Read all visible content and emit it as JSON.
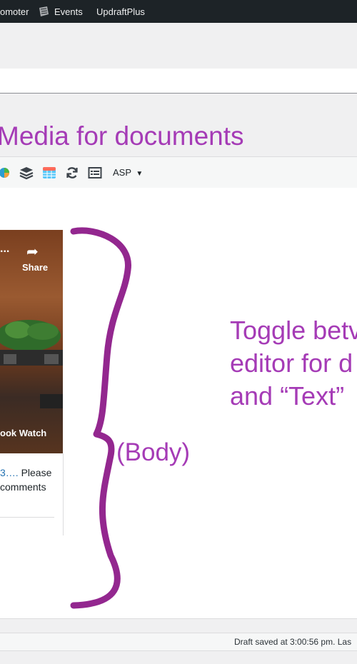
{
  "adminbar": {
    "items": [
      "omoter",
      "Events",
      "UpdraftPlus"
    ]
  },
  "annotations": {
    "heading": "Media for documents",
    "body_label": "(Body)",
    "side_lines": [
      "Toggle betv",
      "editor for d",
      "and “Text”"
    ]
  },
  "toolbar": {
    "asp_label": "ASP",
    "icons": [
      "spinner-icon",
      "layers-icon",
      "table-icon",
      "refresh-icon",
      "form-icon"
    ]
  },
  "embed": {
    "share_label": "Share",
    "dots": "...",
    "watch_label": "ook Watch",
    "text_link": "3….",
    "text_rest": " Please",
    "text_line2": "comments"
  },
  "status": {
    "draft_saved": "Draft saved at 3:00:56 pm. Las"
  },
  "colors": {
    "annotation": "#a53bb6",
    "adminbar": "#1d2327",
    "link": "#2271b1"
  }
}
